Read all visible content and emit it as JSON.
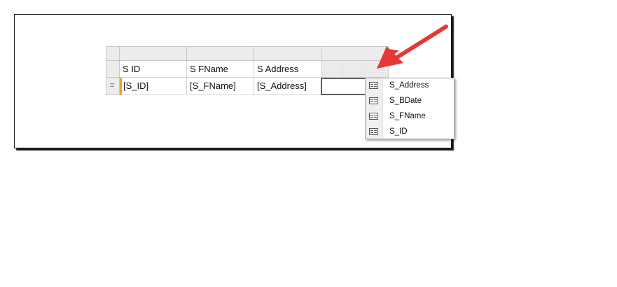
{
  "table": {
    "header_labels": [
      "S ID",
      "S FName",
      "S Address",
      ""
    ],
    "data_expressions": [
      "[S_ID]",
      "[S_FName]",
      "[S_Address]",
      ""
    ],
    "row_handle_glyph": "≡"
  },
  "field_list": {
    "items": [
      "S_Address",
      "S_BDate",
      "S_FName",
      "S_ID"
    ],
    "item_icon": "field-icon"
  },
  "annotation": {
    "arrow_color": "#e53935",
    "arrow_icon": "arrow-pointer"
  },
  "colors": {
    "group_marker": "#e8a33d",
    "selected_border": "#5e5e5e"
  }
}
